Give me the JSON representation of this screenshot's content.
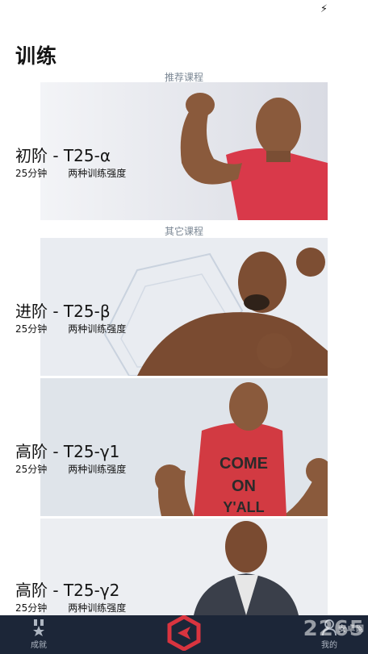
{
  "status": {
    "bolt": "⚡"
  },
  "page_title": "训练",
  "sections": {
    "recommended": "推荐课程",
    "other": "其它课程"
  },
  "courses": [
    {
      "title": "初阶 - T25-α",
      "duration": "25分钟",
      "intensity": "两种训练强度"
    },
    {
      "title": "进阶 - T25-β",
      "duration": "25分钟",
      "intensity": "两种训练强度"
    },
    {
      "title": "高阶 - T25-γ1",
      "duration": "25分钟",
      "intensity": "两种训练强度"
    },
    {
      "title": "高阶 - T25-γ2",
      "duration": "25分钟",
      "intensity": "两种训练强度"
    }
  ],
  "shirt_text": [
    "COME",
    "ON",
    "Y'ALL"
  ],
  "tabbar": {
    "achievements": "成就",
    "mine": "我的",
    "watermark": "2265",
    "watermark_small": "安卓网"
  },
  "colors": {
    "tabbar": "#1c2638",
    "accent": "#d9343f",
    "shirt_red": "#d23a42"
  }
}
